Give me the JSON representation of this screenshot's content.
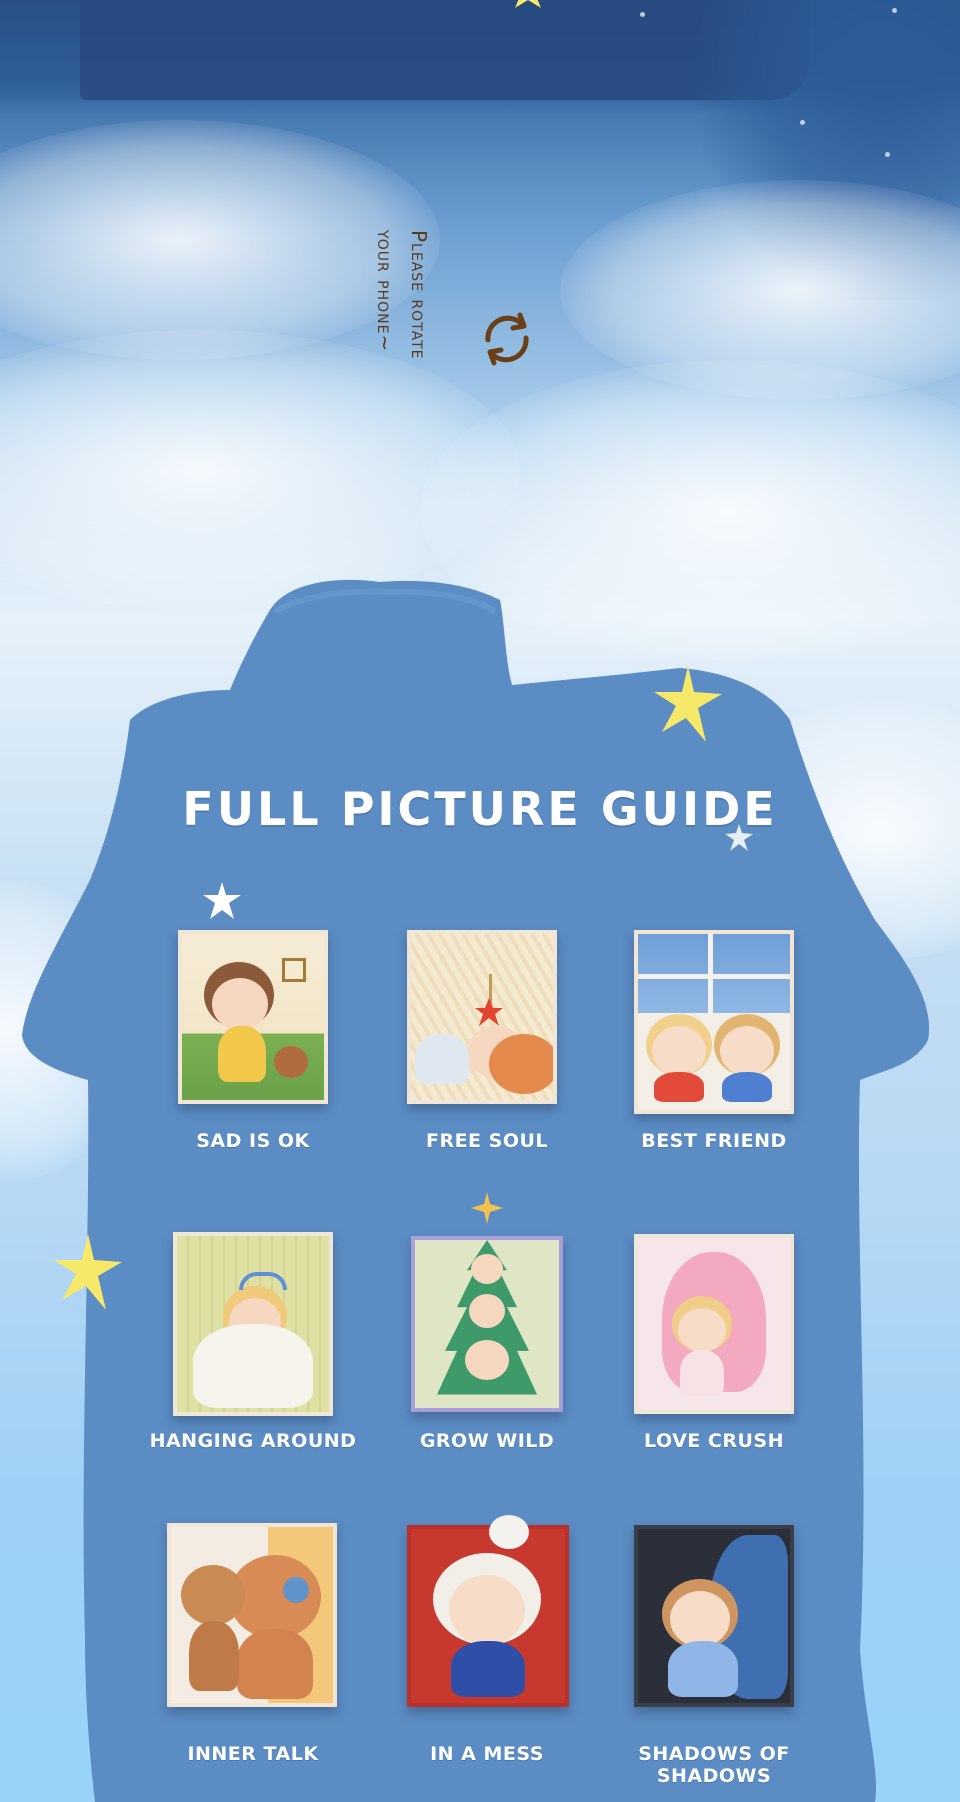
{
  "page": {
    "rotate_hint": {
      "line1": "Please rotate",
      "line2": "your phone~",
      "icon": "rotate-icon"
    },
    "title": "FULL PICTURE GUIDE",
    "colors": {
      "night_sky": "#2e5a93",
      "house": "#5b8cc4",
      "star": "#f6e96a",
      "label": "#ffffff",
      "hint_text": "#5a3b1e"
    },
    "figures": [
      {
        "name": "SAD IS OK",
        "box_color": "#f4e3c6",
        "accent": "#6aa047"
      },
      {
        "name": "FREE SOUL",
        "box_color": "#f2e9d2",
        "accent": "#e2442f"
      },
      {
        "name": "BEST FRIEND",
        "box_color": "#f1ede6",
        "accent": "#7fb6e8"
      },
      {
        "name": "HANGING AROUND",
        "box_color": "#dcd8a1",
        "accent": "#f4f1e8"
      },
      {
        "name": "GROW WILD",
        "box_color": "#eadfb8",
        "accent": "#3e9b69"
      },
      {
        "name": "LOVE CRUSH",
        "box_color": "#f7d4dc",
        "accent": "#f0a9c2"
      },
      {
        "name": "INNER TALK",
        "box_color": "#f3c87a",
        "accent": "#d98b55"
      },
      {
        "name": "IN A MESS",
        "box_color": "#c7382e",
        "accent": "#f2eee8"
      },
      {
        "name": "SHADOWS OF SHADOWS",
        "box_color": "#2b2f3a",
        "accent": "#3f6fb0"
      }
    ]
  }
}
